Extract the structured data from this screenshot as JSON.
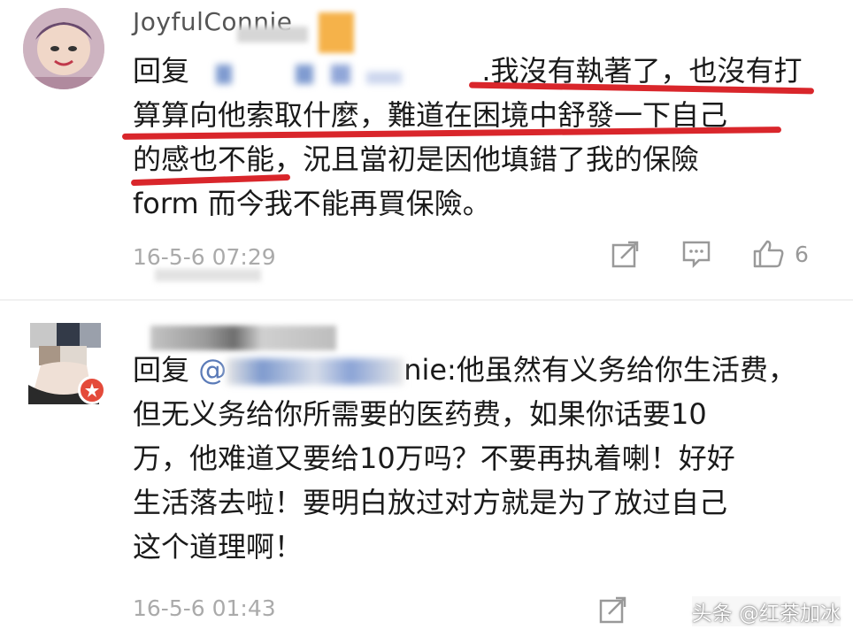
{
  "comments": [
    {
      "username": "JoyfulConnie",
      "reply_prefix": "回复",
      "lines": [
        ".我沒有執著了，也沒有打",
        "算算向他索取什麼，難道在困境中舒發一下自己",
        "的感也不能，況且當初是因他填錯了我的保險",
        "form 而今我不能再買保險。"
      ],
      "time": "16-5-6 07:29",
      "like_count": "6",
      "actions": [
        "share-icon",
        "comment-icon",
        "like-icon"
      ]
    },
    {
      "reply_prefix": "回复",
      "mention": "@",
      "mention_tail": "nie:他虽然有义务给你生活费，",
      "lines": [
        "但无义务给你所需要的医药费，如果你话要10",
        "万，他难道又要给10万吗？不要再执着喇！好好",
        "生活落去啦！要明白放过对方就是为了放过自己",
        "这个道理啊！"
      ],
      "time": "16-5-6 01:43",
      "actions": [
        "share-icon"
      ]
    }
  ],
  "watermark": "头条 @红茶加冰",
  "colors": {
    "underline": "#d9262b",
    "meta_gray": "#aaaaaa"
  }
}
